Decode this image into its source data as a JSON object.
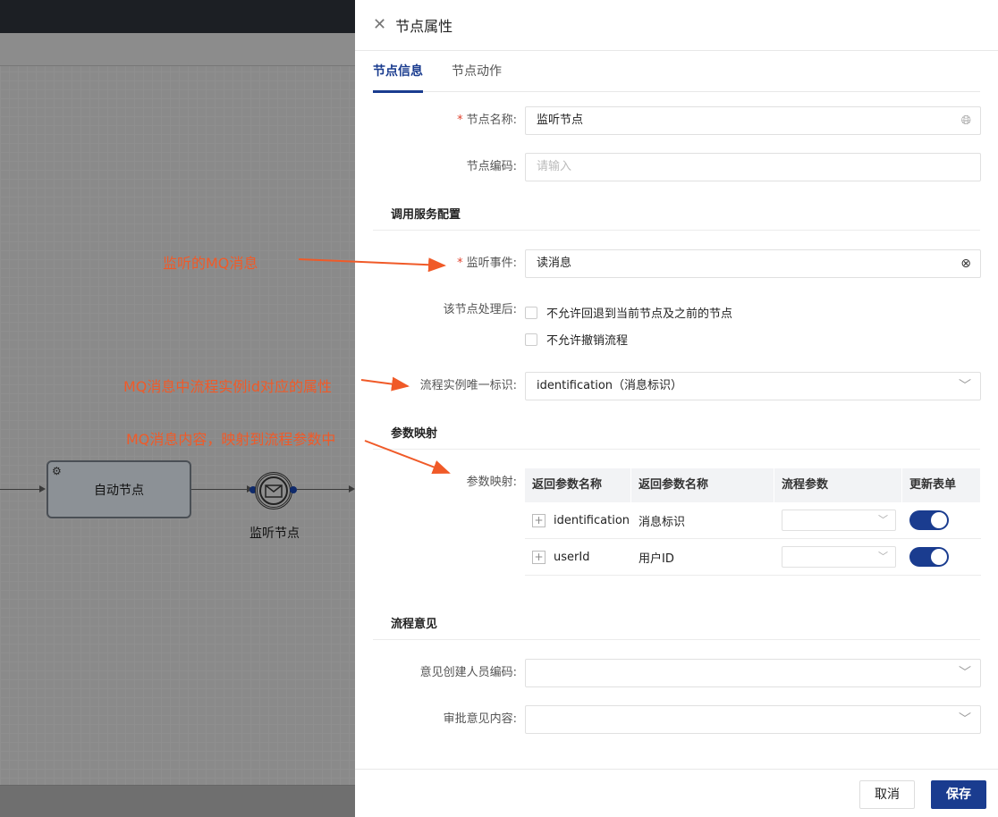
{
  "canvas": {
    "task_node_label": "自动节点",
    "event_node_label": "监听节点"
  },
  "annotations": {
    "mq_message": "监听的MQ消息",
    "instance_id_attr": "MQ消息中流程实例id对应的属性",
    "content_mapping": "MQ消息内容，映射到流程参数中"
  },
  "panel": {
    "title": "节点属性",
    "tabs": [
      {
        "label": "节点信息",
        "active": true
      },
      {
        "label": "节点动作",
        "active": false
      }
    ],
    "node_name": {
      "required_mark": "*",
      "label": "节点名称:",
      "value": "监听节点"
    },
    "node_code": {
      "label": "节点编码:",
      "placeholder": "请输入"
    },
    "section_service": "调用服务配置",
    "listen_event": {
      "required_mark": "*",
      "label": "监听事件:",
      "value": "读消息"
    },
    "after_process": {
      "label": "该节点处理后:",
      "options": [
        "不允许回退到当前节点及之前的节点",
        "不允许撤销流程"
      ]
    },
    "instance_id": {
      "label": "流程实例唯一标识:",
      "value": "identification（消息标识）"
    },
    "section_mapping": "参数映射",
    "mapping": {
      "label": "参数映射:",
      "columns": [
        "返回参数名称",
        "返回参数名称",
        "流程参数",
        "更新表单"
      ],
      "rows": [
        {
          "name": "identification",
          "desc": "消息标识",
          "update_form": true
        },
        {
          "name": "userId",
          "desc": "用户ID",
          "update_form": true
        }
      ]
    },
    "section_opinion": "流程意见",
    "opinion_creator": {
      "label": "意见创建人员编码:"
    },
    "opinion_content": {
      "label": "审批意见内容:"
    },
    "footer": {
      "cancel": "取消",
      "save": "保存"
    }
  }
}
